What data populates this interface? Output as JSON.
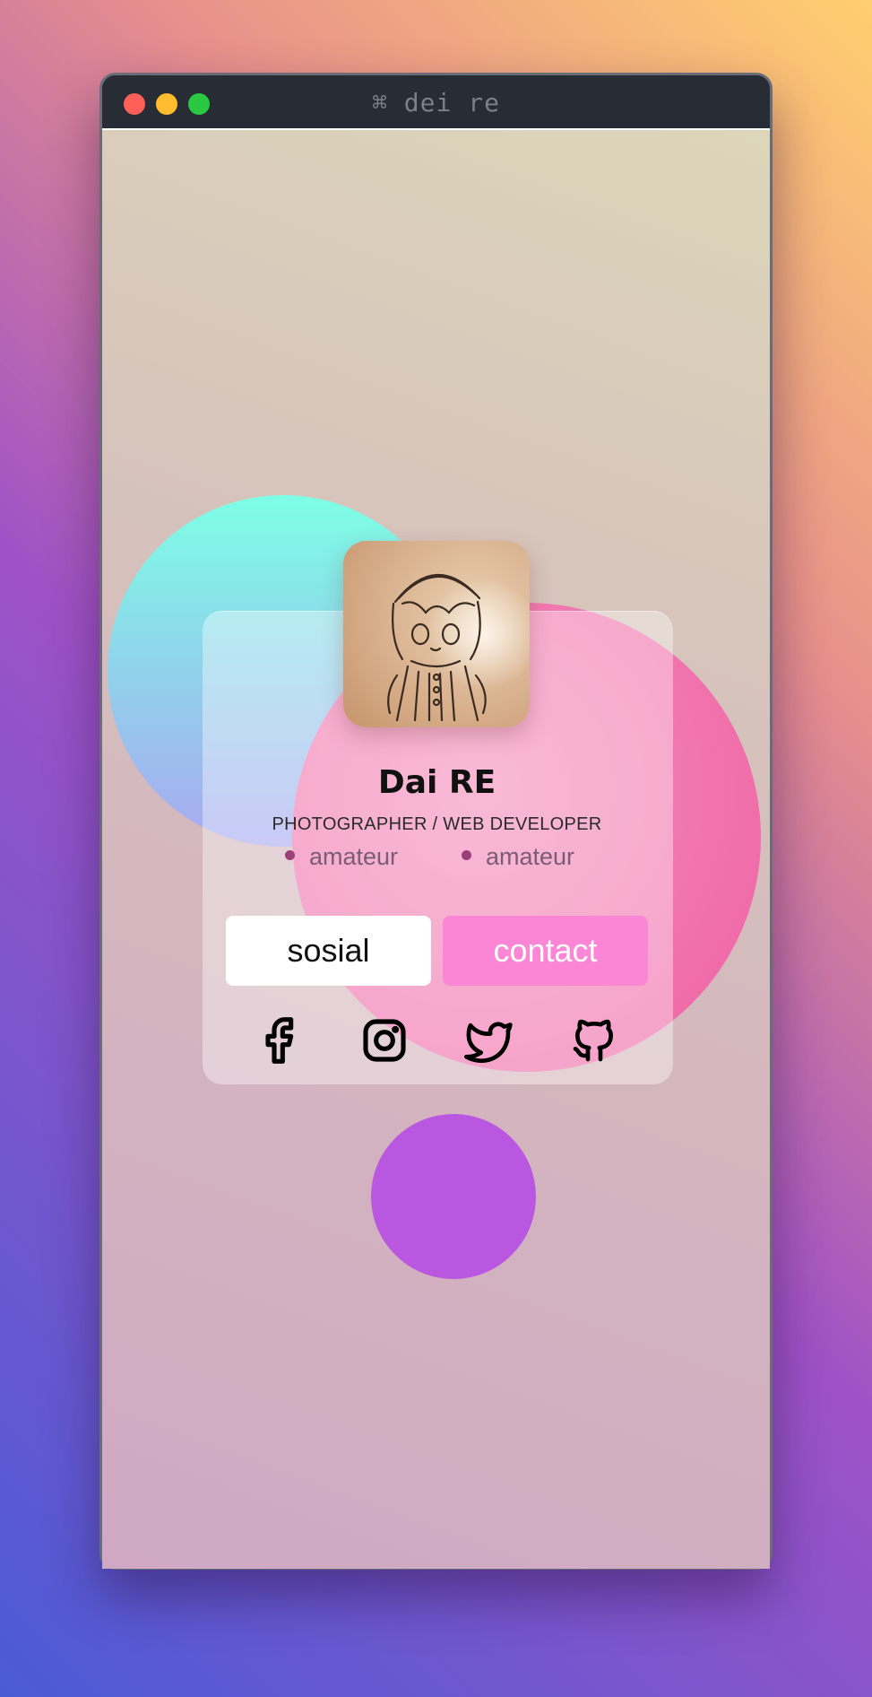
{
  "window": {
    "title": "⌘ dei re",
    "controls": [
      "close",
      "minimize",
      "maximize"
    ]
  },
  "profile": {
    "name": "Dai RE",
    "role": "PHOTOGRAPHER / WEB DEVELOPER",
    "tags": [
      "amateur",
      "amateur"
    ],
    "avatar_icon": "avatar-photo"
  },
  "buttons": {
    "sosial": "sosial",
    "contact": "contact"
  },
  "social": [
    "facebook-icon",
    "instagram-icon",
    "twitter-icon",
    "github-icon"
  ],
  "colors": {
    "contact_button": "#fc86d6",
    "blob_teal": "#7effe6",
    "blob_pink": "#f06eaa",
    "blob_purple": "#b957e0"
  }
}
